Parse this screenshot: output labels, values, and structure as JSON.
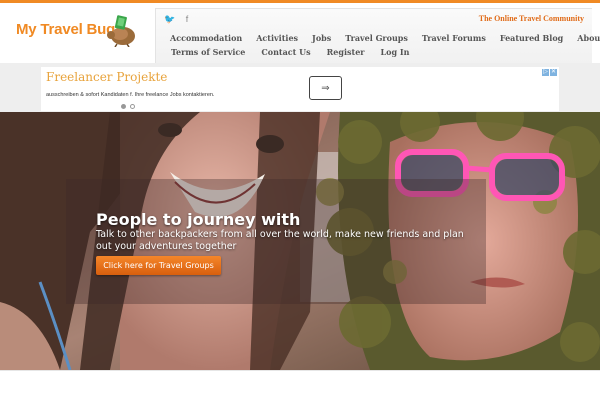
{
  "logo": {
    "text": "My Travel Bug"
  },
  "header": {
    "social": [
      {
        "icon": "twitter-icon",
        "glyph": "🐦"
      },
      {
        "icon": "facebook-icon",
        "glyph": "f"
      }
    ],
    "tagline": "The Online Travel Community"
  },
  "nav": {
    "row1": [
      "Accommodation",
      "Activities",
      "Jobs",
      "Travel Groups",
      "Travel Forums",
      "Featured Blog",
      "About"
    ],
    "row2": [
      "Terms of Service",
      "Contact Us",
      "Register",
      "Log In"
    ]
  },
  "ad": {
    "title": "Freelancer Projekte",
    "subtitle": "ausschreiben & sofort Kandidaten f. Ihre freelance Jobs kontaktieren.",
    "button_glyph": "⇒",
    "close_glyphs": [
      "▷",
      "✕"
    ]
  },
  "hero": {
    "title": "People to journey with",
    "text": "Talk to other backpackers from all over the world, make new friends and plan out your adventures together",
    "button": "Click here for Travel Groups"
  },
  "colors": {
    "accent": "#f08a24",
    "button": "#e56b16"
  }
}
